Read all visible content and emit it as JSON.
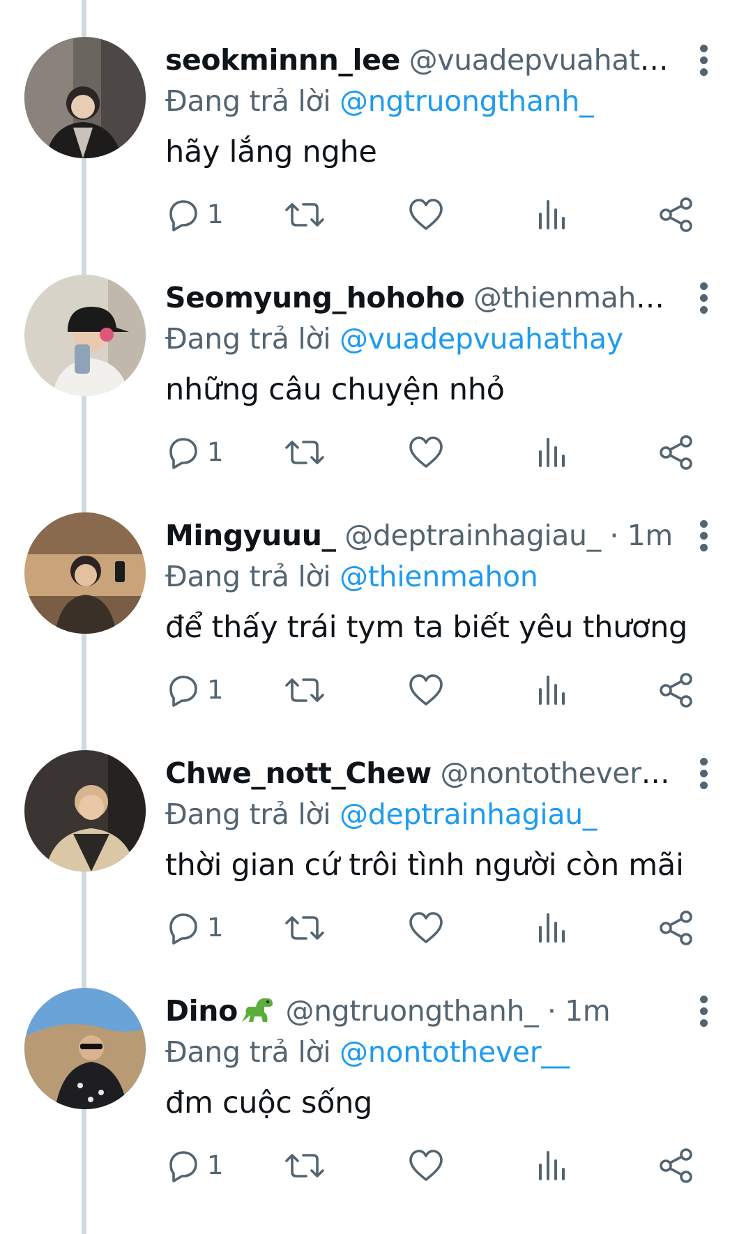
{
  "reply_prefix": "Đang trả lời",
  "tweets": [
    {
      "name": "seokminnn_lee",
      "handle": "@vuadepvuahath...",
      "dot": "",
      "time": "",
      "emoji": "",
      "replying_to": "@ngtruongthanh_",
      "text": "hãy lắng nghe",
      "reply_count": "1",
      "avatar_colors": [
        "#6b6560",
        "#2a2624"
      ]
    },
    {
      "name": "Seomyung_hohoho",
      "handle": "@thienmaho...",
      "dot": "",
      "time": "",
      "emoji": "",
      "replying_to": "@vuadepvuahathay",
      "text": "những câu chuyện nhỏ",
      "reply_count": "1",
      "avatar_colors": [
        "#d8d3c9",
        "#1a1a1a"
      ]
    },
    {
      "name": "Mingyuuu_",
      "handle": "@deptrainhagiau_",
      "dot": "·",
      "time": "1m",
      "emoji": "",
      "replying_to": "@thienmahon",
      "text": "để thấy trái tym ta biết yêu thương",
      "reply_count": "1",
      "avatar_colors": [
        "#c9a37a",
        "#3b3028"
      ]
    },
    {
      "name": "Chwe_nott_Chew",
      "handle": "@nontothever_...",
      "dot": "",
      "time": "",
      "emoji": "",
      "replying_to": "@deptrainhagiau_",
      "text": "thời gian cứ trôi tình người còn mãi",
      "reply_count": "1",
      "avatar_colors": [
        "#3a3532",
        "#d9c7a6"
      ]
    },
    {
      "name": "Dino",
      "handle": "@ngtruongthanh_",
      "dot": "·",
      "time": "1m",
      "emoji": "dinosaur-emoji",
      "replying_to": "@nontothever__",
      "text": "đm cuộc sống",
      "reply_count": "1",
      "avatar_colors": [
        "#6aa3d8",
        "#b89a74"
      ]
    }
  ],
  "colors": {
    "text_primary": "#0f1419",
    "text_secondary": "#536471",
    "mention": "#1d9bf0",
    "thread_line": "#cfd9de"
  },
  "icons": {
    "reply": "reply-icon",
    "retweet": "retweet-icon",
    "like": "like-icon",
    "views": "views-icon",
    "share": "share-icon",
    "more": "more-icon"
  }
}
